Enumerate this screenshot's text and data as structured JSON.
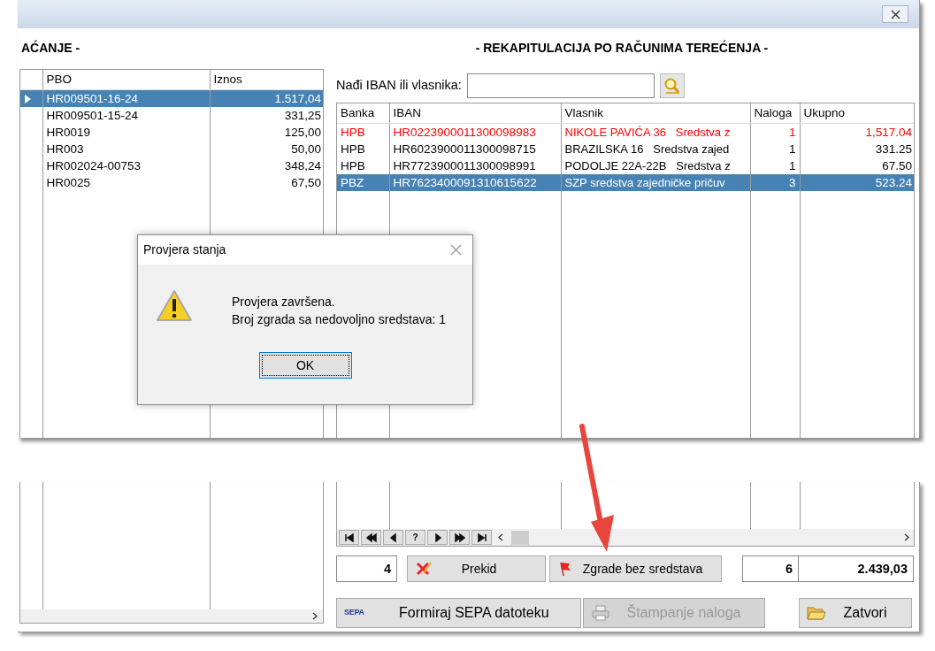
{
  "left_panel": {
    "heading": "AĆANJE -",
    "columns": [
      "PBO",
      "Iznos"
    ],
    "rows": [
      {
        "pbo": "HR009501-16-24",
        "amount": "1.517,04",
        "selected": true
      },
      {
        "pbo": "HR009501-15-24",
        "amount": "331,25",
        "selected": false
      },
      {
        "pbo": "HR0019",
        "amount": "125,00",
        "selected": false
      },
      {
        "pbo": "HR003",
        "amount": "50,00",
        "selected": false
      },
      {
        "pbo": "HR002024-00753",
        "amount": "348,24",
        "selected": false
      },
      {
        "pbo": "HR0025",
        "amount": "67,50",
        "selected": false
      }
    ]
  },
  "right_panel": {
    "heading": "- REKAPITULACIJA PO RAČUNIMA TEREĆENJA -",
    "search": {
      "label": "Nađi IBAN ili vlasnika:"
    },
    "columns": [
      "Banka",
      "IBAN",
      "Vlasnik",
      "Naloga",
      "Ukupno"
    ],
    "rows": [
      {
        "cells": [
          "HPB",
          "HR0223900011300098983",
          "NIKOLE PAVIĆA 36   Sredstva z",
          "1",
          "1,517.04"
        ],
        "flagged": true,
        "selected": false
      },
      {
        "cells": [
          "HPB",
          "HR6023900011300098715",
          "BRAZILSKA 16   Sredstva zajed",
          "1",
          "331.25"
        ],
        "flagged": false,
        "selected": false
      },
      {
        "cells": [
          "HPB",
          "HR7723900011300098991",
          "PODOLJE 22A-22B   Sredstva z",
          "1",
          "67.50"
        ],
        "flagged": false,
        "selected": false
      },
      {
        "cells": [
          "PBZ",
          "HR7623400091310615622",
          "SZP sredstva zajedničke pričuv",
          "3",
          "523.24"
        ],
        "flagged": false,
        "selected": true
      }
    ],
    "nav_buttons": [
      {
        "kind": "first"
      },
      {
        "kind": "prev_page"
      },
      {
        "kind": "prev"
      },
      {
        "kind": "help",
        "label": "?"
      },
      {
        "kind": "next"
      },
      {
        "kind": "next_page"
      },
      {
        "kind": "last"
      }
    ],
    "count": "4",
    "buttons": [
      {
        "kind": "cancel",
        "label": "Prekid"
      },
      {
        "kind": "flag",
        "label": "Zgrade bez sredstava"
      }
    ],
    "total_orders": "6",
    "total_amount": "2.439,03"
  },
  "actions": [
    {
      "kind": "sepa",
      "label": "Formiraj SEPA datoteku",
      "logo_text": "SEPA",
      "disabled": false
    },
    {
      "kind": "print",
      "label": "Štampanje naloga",
      "disabled": true
    },
    {
      "kind": "folder",
      "label": "Zatvori",
      "disabled": false
    }
  ],
  "dialog": {
    "title": "Provjera stanja",
    "lines": [
      "Provjera završena.",
      "Broj zgrada sa nedovoljno sredstava: 1"
    ],
    "button": "OK"
  }
}
